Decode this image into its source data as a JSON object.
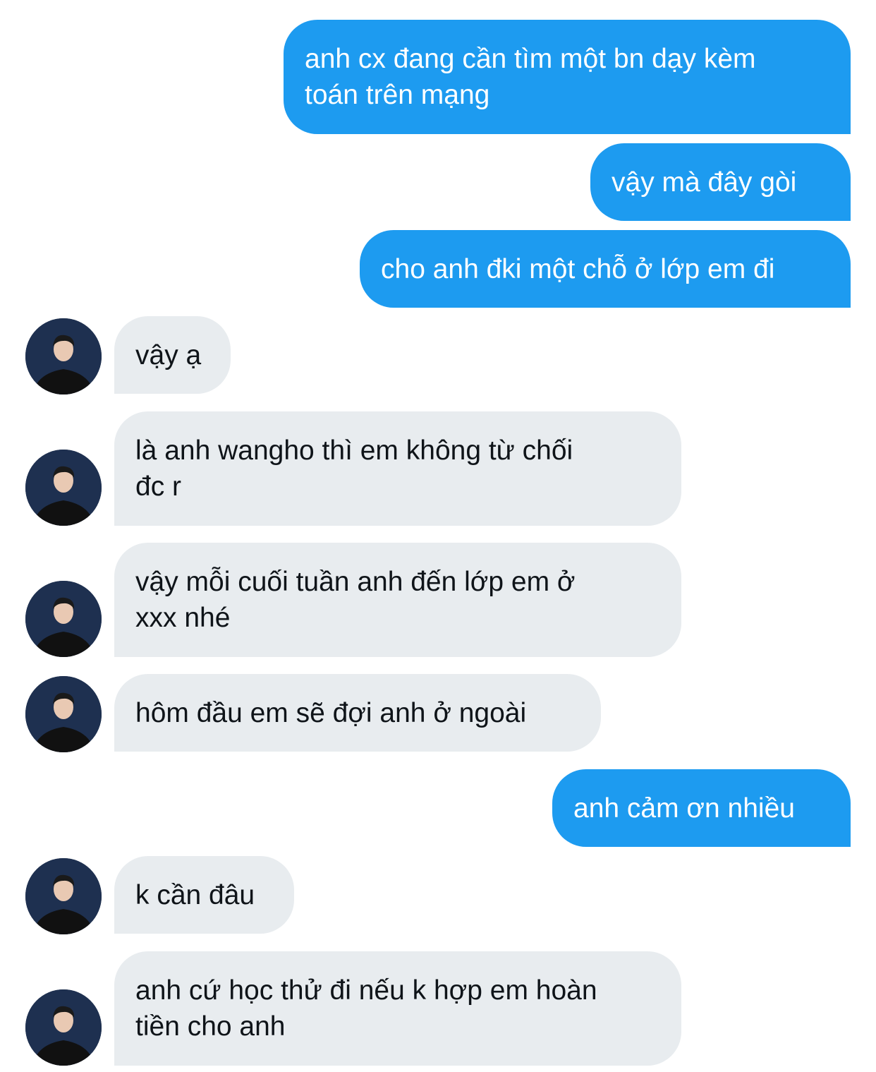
{
  "conversation": {
    "messages": [
      {
        "direction": "sent",
        "text": "anh cx đang cần tìm một bn dạy kèm\ntoán trên mạng"
      },
      {
        "direction": "sent",
        "text": "vậy mà đây gòi"
      },
      {
        "direction": "sent",
        "text": "cho anh đki một chỗ ở lớp em đi"
      },
      {
        "direction": "received",
        "text": "vậy ạ",
        "avatar": "profile-photo"
      },
      {
        "direction": "received",
        "text": "là anh wangho thì em không từ chối\nđc r",
        "avatar": "profile-photo"
      },
      {
        "direction": "received",
        "text": "vậy mỗi cuối tuần anh đến lớp em ở\nxxx nhé",
        "avatar": "profile-photo"
      },
      {
        "direction": "received",
        "text": "hôm đầu em sẽ đợi anh ở ngoài",
        "avatar": "profile-photo"
      },
      {
        "direction": "sent",
        "text": "anh cảm ơn nhiều"
      },
      {
        "direction": "received",
        "text": "k cần đâu",
        "avatar": "profile-photo"
      },
      {
        "direction": "received",
        "text": "anh cứ học thử đi nếu k hợp em hoàn\ntiền cho anh",
        "avatar": "profile-photo"
      }
    ]
  },
  "colors": {
    "sent_bubble": "#1d9bf0",
    "received_bubble": "#e8ecef",
    "sent_text": "#ffffff",
    "received_text": "#0f1419"
  }
}
